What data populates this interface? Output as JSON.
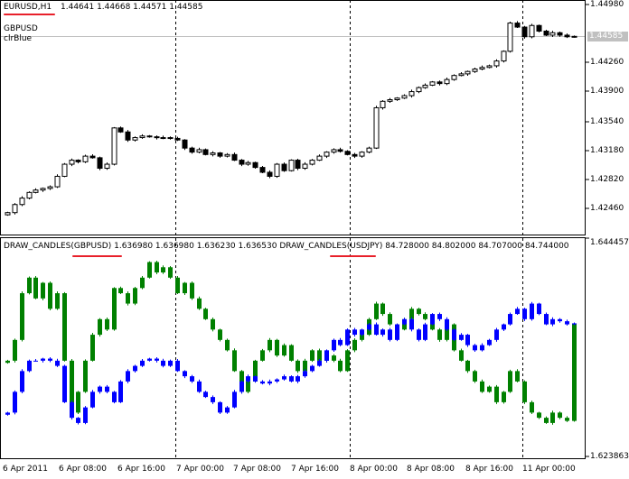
{
  "main": {
    "symbol_label": "EURUSD,H1",
    "ohlc_text": "1.44641 1.44668 1.44571 1.44585",
    "indicator_name": "GBPUSD",
    "indicator_color_label": "clrBlue",
    "current_price": "1.44585",
    "axis_labels": [
      "1.44980",
      "1.44260",
      "1.43900",
      "1.43540",
      "1.43180",
      "1.42820",
      "1.42460"
    ]
  },
  "sub": {
    "series1_label": "DRAW_CANDLES(GBPUSD)",
    "series1_values": "1.636980 1.636980 1.636230 1.636530",
    "series2_label": "DRAW_CANDLES(USDJPY)",
    "series2_values": "84.728000 84.802000 84.707000 84.744000",
    "axis_max": "1.644457",
    "axis_min": "1.623863"
  },
  "time_axis": [
    "6 Apr 2011",
    "6 Apr 08:00",
    "6 Apr 16:00",
    "7 Apr 00:00",
    "7 Apr 08:00",
    "7 Apr 16:00",
    "8 Apr 00:00",
    "8 Apr 08:00",
    "8 Apr 16:00",
    "11 Apr 00:00"
  ],
  "colors": {
    "gbpusd": "#008000",
    "usdjpy": "#0000ff",
    "bull_fill": "#ffffff",
    "bear_fill": "#000000",
    "current_price_line": "#c0c0c0",
    "underline": "#e8202a"
  },
  "chart_data": [
    {
      "type": "candlestick",
      "title": "EURUSD,H1",
      "ylim": [
        1.4224,
        1.4498
      ],
      "closes": [
        1.424,
        1.425,
        1.4258,
        1.4265,
        1.4268,
        1.427,
        1.4272,
        1.4285,
        1.43,
        1.4305,
        1.4303,
        1.431,
        1.4308,
        1.4295,
        1.43,
        1.4345,
        1.434,
        1.433,
        1.4333,
        1.4335,
        1.4334,
        1.4333,
        1.4333,
        1.4332,
        1.433,
        1.432,
        1.4315,
        1.4318,
        1.4312,
        1.4314,
        1.431,
        1.4312,
        1.4305,
        1.43,
        1.4302,
        1.4296,
        1.429,
        1.4285,
        1.43,
        1.4292,
        1.4305,
        1.4295,
        1.43,
        1.4305,
        1.431,
        1.4315,
        1.4318,
        1.4316,
        1.4312,
        1.431,
        1.4315,
        1.432,
        1.437,
        1.4378,
        1.438,
        1.4382,
        1.4385,
        1.439,
        1.4395,
        1.4398,
        1.4402,
        1.44,
        1.4405,
        1.441,
        1.4412,
        1.4415,
        1.4418,
        1.442,
        1.4422,
        1.4428,
        1.444,
        1.4475,
        1.447,
        1.4458,
        1.4472,
        1.4465,
        1.446,
        1.4463,
        1.446,
        1.4458,
        1.44585
      ]
    },
    {
      "type": "candlestick",
      "title": "DRAW_CANDLES",
      "ylim": [
        1.623863,
        1.644457
      ],
      "series": [
        {
          "name": "GBPUSD",
          "closes": [
            1.633,
            1.635,
            1.6395,
            1.641,
            1.639,
            1.6405,
            1.638,
            1.6395,
            1.633,
            1.628,
            1.63,
            1.633,
            1.6355,
            1.637,
            1.636,
            1.64,
            1.6395,
            1.6385,
            1.64,
            1.641,
            1.6425,
            1.6415,
            1.642,
            1.641,
            1.6395,
            1.6405,
            1.639,
            1.638,
            1.637,
            1.636,
            1.635,
            1.634,
            1.632,
            1.63,
            1.631,
            1.633,
            1.634,
            1.635,
            1.6335,
            1.6345,
            1.633,
            1.632,
            1.633,
            1.634,
            1.633,
            1.6335,
            1.633,
            1.632,
            1.634,
            1.635,
            1.6355,
            1.637,
            1.6385,
            1.6375,
            1.6365,
            1.636,
            1.637,
            1.638,
            1.6375,
            1.637,
            1.636,
            1.635,
            1.6365,
            1.634,
            1.633,
            1.632,
            1.631,
            1.63,
            1.6305,
            1.629,
            1.63,
            1.632,
            1.631,
            1.629,
            1.628,
            1.6275,
            1.627,
            1.628,
            1.6275,
            1.6272,
            1.63653
          ]
        },
        {
          "name": "USDJPY",
          "closes": [
            1.628,
            1.63,
            1.632,
            1.633,
            1.633,
            1.6332,
            1.633,
            1.6325,
            1.629,
            1.6275,
            1.627,
            1.6285,
            1.63,
            1.6305,
            1.63,
            1.629,
            1.631,
            1.632,
            1.6325,
            1.633,
            1.6332,
            1.633,
            1.6325,
            1.633,
            1.632,
            1.6315,
            1.631,
            1.63,
            1.6295,
            1.629,
            1.628,
            1.6285,
            1.63,
            1.631,
            1.6315,
            1.631,
            1.6308,
            1.631,
            1.6312,
            1.6315,
            1.631,
            1.6315,
            1.632,
            1.6325,
            1.633,
            1.634,
            1.635,
            1.6345,
            1.636,
            1.6355,
            1.636,
            1.6365,
            1.6355,
            1.636,
            1.635,
            1.6365,
            1.637,
            1.636,
            1.635,
            1.6365,
            1.6375,
            1.637,
            1.636,
            1.635,
            1.6355,
            1.6345,
            1.634,
            1.6345,
            1.635,
            1.636,
            1.6365,
            1.6375,
            1.638,
            1.637,
            1.6385,
            1.6375,
            1.6365,
            1.637,
            1.6368,
            1.6365,
            1.6366
          ]
        }
      ]
    }
  ]
}
